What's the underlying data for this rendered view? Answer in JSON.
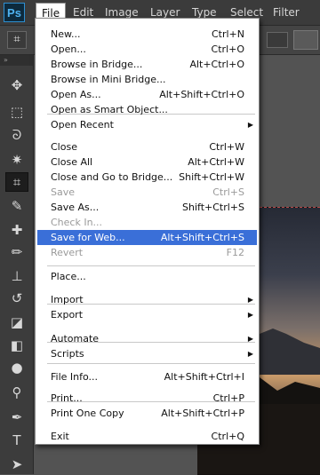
{
  "app": {
    "logo": "Ps"
  },
  "menubar": {
    "items": [
      "File",
      "Edit",
      "Image",
      "Layer",
      "Type",
      "Select",
      "Filter"
    ],
    "active": "File"
  },
  "options_bar": {
    "tool_icon": "crop-icon"
  },
  "toolbar": {
    "collapse_label": "»",
    "tools": [
      {
        "name": "move-tool",
        "icon": "✥"
      },
      {
        "name": "marquee-tool",
        "icon": "⬚"
      },
      {
        "name": "lasso-tool",
        "icon": "ᘐ"
      },
      {
        "name": "magic-wand-tool",
        "icon": "✷"
      },
      {
        "name": "crop-tool",
        "icon": "⌗"
      },
      {
        "name": "eyedropper-tool",
        "icon": "✎"
      },
      {
        "name": "healing-brush-tool",
        "icon": "✚"
      },
      {
        "name": "brush-tool",
        "icon": "✏"
      },
      {
        "name": "clone-stamp-tool",
        "icon": "⊥"
      },
      {
        "name": "history-brush-tool",
        "icon": "↺"
      },
      {
        "name": "eraser-tool",
        "icon": "◪"
      },
      {
        "name": "paint-bucket-tool",
        "icon": "◧"
      },
      {
        "name": "blur-tool",
        "icon": "●"
      },
      {
        "name": "dodge-tool",
        "icon": "⚲"
      },
      {
        "name": "pen-tool",
        "icon": "✒"
      },
      {
        "name": "type-tool",
        "icon": "T"
      },
      {
        "name": "path-selection-tool",
        "icon": "➤"
      }
    ]
  },
  "file_menu": {
    "items": [
      {
        "label": "New...",
        "shortcut": "Ctrl+N"
      },
      {
        "label": "Open...",
        "shortcut": "Ctrl+O"
      },
      {
        "label": "Browse in Bridge...",
        "shortcut": "Alt+Ctrl+O"
      },
      {
        "label": "Browse in Mini Bridge...",
        "shortcut": ""
      },
      {
        "label": "Open As...",
        "shortcut": "Alt+Shift+Ctrl+O"
      },
      {
        "label": "Open as Smart Object...",
        "shortcut": ""
      },
      {
        "label": "Open Recent",
        "shortcut": "",
        "submenu": true
      },
      {
        "label": "Close",
        "shortcut": "Ctrl+W"
      },
      {
        "label": "Close All",
        "shortcut": "Alt+Ctrl+W"
      },
      {
        "label": "Close and Go to Bridge...",
        "shortcut": "Shift+Ctrl+W"
      },
      {
        "label": "Save",
        "shortcut": "Ctrl+S",
        "disabled": true
      },
      {
        "label": "Save As...",
        "shortcut": "Shift+Ctrl+S"
      },
      {
        "label": "Check In...",
        "shortcut": "",
        "disabled": true
      },
      {
        "label": "Save for Web...",
        "shortcut": "Alt+Shift+Ctrl+S",
        "highlighted": true
      },
      {
        "label": "Revert",
        "shortcut": "F12",
        "disabled": true
      },
      {
        "label": "Place...",
        "shortcut": ""
      },
      {
        "label": "Import",
        "shortcut": "",
        "submenu": true
      },
      {
        "label": "Export",
        "shortcut": "",
        "submenu": true
      },
      {
        "label": "Automate",
        "shortcut": "",
        "submenu": true
      },
      {
        "label": "Scripts",
        "shortcut": "",
        "submenu": true
      },
      {
        "label": "File Info...",
        "shortcut": "Alt+Shift+Ctrl+I"
      },
      {
        "label": "Print...",
        "shortcut": "Ctrl+P"
      },
      {
        "label": "Print One Copy",
        "shortcut": "Alt+Shift+Ctrl+P"
      },
      {
        "label": "Exit",
        "shortcut": "Ctrl+Q"
      }
    ]
  }
}
